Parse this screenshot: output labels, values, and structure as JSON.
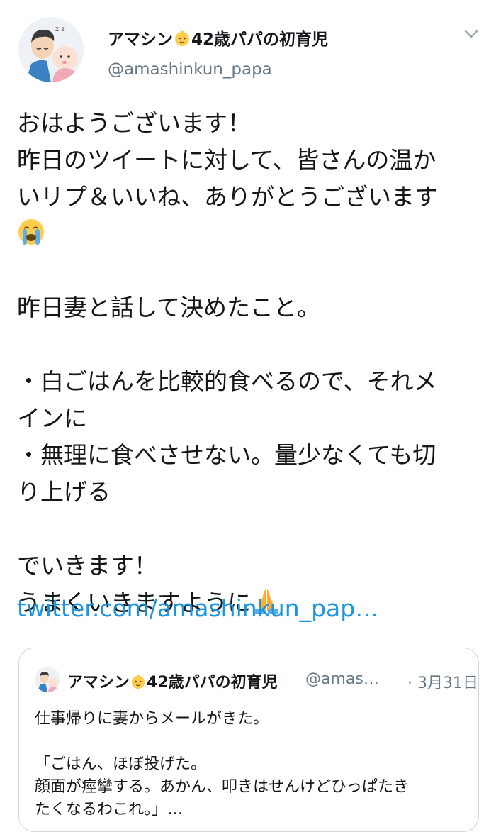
{
  "author": {
    "name_prefix": "アマシン",
    "name_suffix": "42歳パパの初育児",
    "handle": "@amashinkun_papa"
  },
  "icons": {
    "avatar": "avatar-dad-with-baby",
    "name_emoji": "baby-emoji-icon",
    "menu": "chevron-down-icon",
    "crying_emoji": "loudly-crying-face-icon",
    "pray_emoji": "folded-hands-icon"
  },
  "tweet": {
    "lines": {
      "l1": "おはようございます！",
      "l2": "昨日のツイートに対して、皆さんの温か",
      "l3": "いリプ＆いいね、ありがとうございます",
      "l5": "昨日妻と話して決めたこと。",
      "l7": "・白ごはんを比較的食べるので、それメ",
      "l8": "インに",
      "l9": "・無理に食べさせない。量少なくても切",
      "l10": "り上げる",
      "l12": "でいきます！",
      "l13": "うまくいきますように"
    },
    "link": "twitter.com/amashinkun_pap…"
  },
  "quoted": {
    "name_prefix": "アマシン",
    "name_suffix": "42歳パパの初育児",
    "handle": "@amas…",
    "date": "· 3月31日",
    "lines": {
      "l1": "仕事帰りに妻からメールがきた。",
      "l3": "「ごはん、ほぼ投げた。",
      "l4": "顔面が痙攣する。あかん、叩きはせんけどひっぱたき",
      "l5": "たくなるわこれ。」…"
    }
  },
  "colors": {
    "text": "#14171a",
    "secondary": "#657786",
    "link": "#1b95e0",
    "border": "#ccd6dd"
  }
}
